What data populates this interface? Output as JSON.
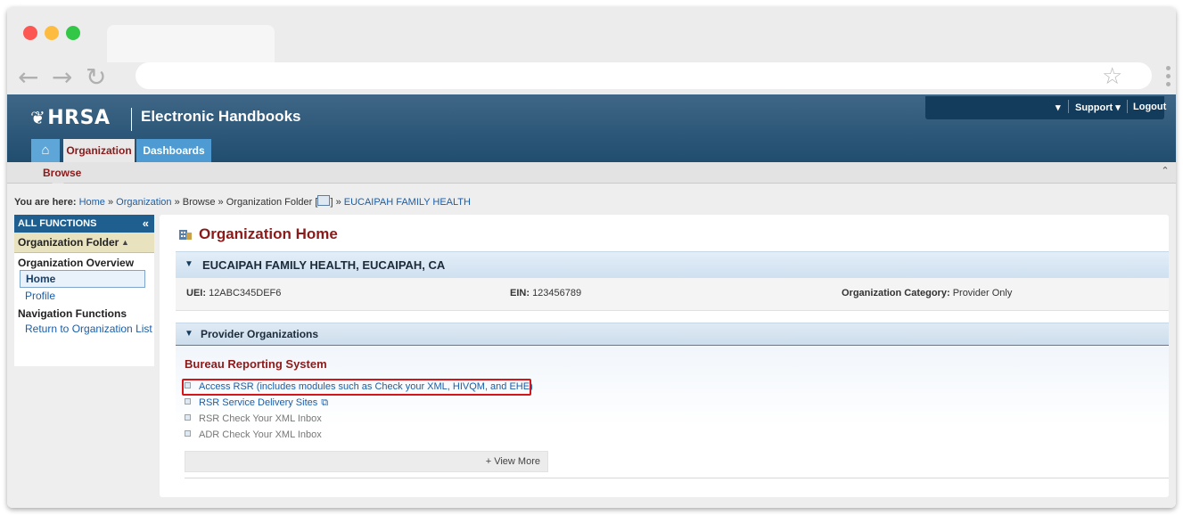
{
  "header": {
    "logo_text": "HRSA",
    "app_title": "Electronic Handbooks",
    "user_menu_caret": "▾",
    "support_label": "Support ▾",
    "logout_label": "Logout"
  },
  "nav": {
    "home_icon": "home-icon",
    "tabs": [
      {
        "label": "Organization",
        "active": true
      },
      {
        "label": "Dashboards",
        "active": false
      }
    ],
    "subnav_label": "Browse"
  },
  "breadcrumb": {
    "prefix": "You are here:",
    "home": "Home",
    "sep": "»",
    "organization": "Organization",
    "browse": "Browse",
    "folder": "Organization Folder [",
    "folder_close": "]",
    "current": "EUCAIPAH FAMILY HEALTH"
  },
  "sidebar": {
    "title": "ALL FUNCTIONS",
    "collapse_glyph": "«",
    "folder_label": "Organization Folder",
    "folder_arrow": "▲",
    "sections": [
      {
        "title": "Organization Overview",
        "items": [
          {
            "label": "Home",
            "active": true
          },
          {
            "label": "Profile",
            "active": false
          }
        ]
      },
      {
        "title": "Navigation Functions",
        "items": [
          {
            "label": "Return to Organization List",
            "active": false
          }
        ]
      }
    ]
  },
  "main": {
    "title": "Organization Home",
    "org_name": "EUCAIPAH FAMILY HEALTH, EUCAIPAH, CA",
    "uei_label": "UEI:",
    "uei_value": "12ABC345DEF6",
    "ein_label": "EIN:",
    "ein_value": "123456789",
    "category_label": "Organization Category:",
    "category_value": "Provider Only",
    "provider_section": "Provider Organizations",
    "system_title": "Bureau Reporting System",
    "links": [
      {
        "label": "Access RSR (includes modules such as Check your XML, HIVQM, and EHE)",
        "enabled": true,
        "external": false
      },
      {
        "label": "RSR Service Delivery Sites",
        "enabled": true,
        "external": true
      },
      {
        "label": "RSR Check Your XML Inbox",
        "enabled": false,
        "external": false
      },
      {
        "label": "ADR Check Your XML Inbox",
        "enabled": false,
        "external": false
      }
    ],
    "view_more": "+ View More"
  },
  "colors": {
    "header_blue": "#1d4a6c",
    "maroon": "#8b1a1a",
    "link_blue": "#1a5ea8",
    "highlight_red": "#d4151a"
  }
}
